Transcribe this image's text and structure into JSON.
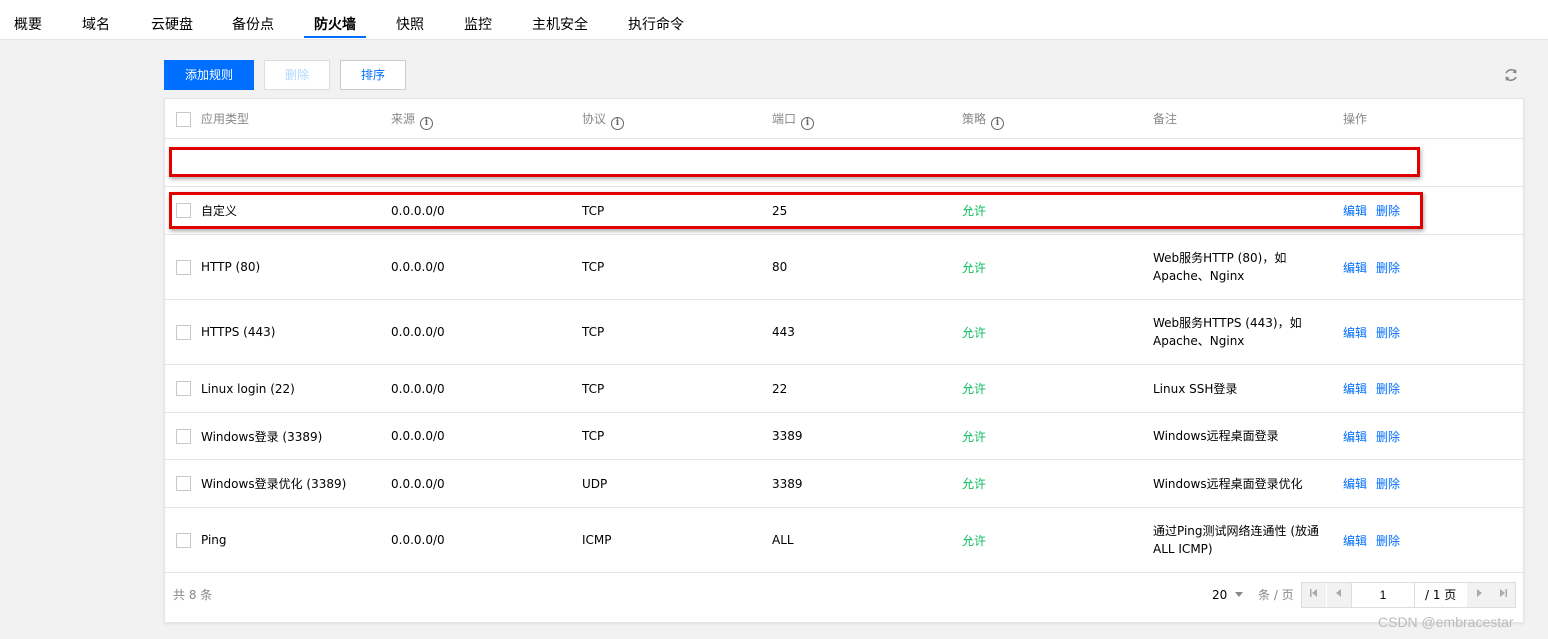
{
  "tabs": [
    {
      "label": "概要"
    },
    {
      "label": "域名"
    },
    {
      "label": "云硬盘"
    },
    {
      "label": "备份点"
    },
    {
      "label": "防火墙"
    },
    {
      "label": "快照"
    },
    {
      "label": "监控"
    },
    {
      "label": "主机安全"
    },
    {
      "label": "执行命令"
    }
  ],
  "active_tab": "防火墙",
  "toolbar": {
    "add_rule_label": "添加规则",
    "delete_label": "删除",
    "sort_label": "排序"
  },
  "table": {
    "headers": {
      "app_type": "应用类型",
      "source": "来源",
      "protocol": "协议",
      "port": "端口",
      "policy": "策略",
      "note": "备注",
      "action": "操作"
    },
    "rows": [
      {
        "app_type": "自定义",
        "source": "0.0.0.0/0",
        "protocol": "TCP",
        "port": "25",
        "policy": "允许",
        "note": ""
      },
      {
        "app_type": "HTTP (80)",
        "source": "0.0.0.0/0",
        "protocol": "TCP",
        "port": "80",
        "policy": "允许",
        "note": "Web服务HTTP (80)，如Apache、Nginx"
      },
      {
        "app_type": "HTTPS (443)",
        "source": "0.0.0.0/0",
        "protocol": "TCP",
        "port": "443",
        "policy": "允许",
        "note": "Web服务HTTPS (443)，如Apache、Nginx"
      },
      {
        "app_type": "Linux login (22)",
        "source": "0.0.0.0/0",
        "protocol": "TCP",
        "port": "22",
        "policy": "允许",
        "note": "Linux SSH登录"
      },
      {
        "app_type": "Windows登录 (3389)",
        "source": "0.0.0.0/0",
        "protocol": "TCP",
        "port": "3389",
        "policy": "允许",
        "note": "Windows远程桌面登录"
      },
      {
        "app_type": "Windows登录优化 (3389)",
        "source": "0.0.0.0/0",
        "protocol": "UDP",
        "port": "3389",
        "policy": "允许",
        "note": "Windows远程桌面登录优化"
      },
      {
        "app_type": "Ping",
        "source": "0.0.0.0/0",
        "protocol": "ICMP",
        "port": "ALL",
        "policy": "允许",
        "note": "通过Ping测试网络连通性 (放通ALL ICMP)"
      }
    ],
    "edit_label": "编辑",
    "delete_label": "删除"
  },
  "footer": {
    "total": "共 8 条",
    "page_size": "20",
    "page_size_unit": "条 / 页",
    "current_page": "1",
    "total_pages": "/ 1 页"
  },
  "watermark": "CSDN @embracestar",
  "colors": {
    "primary": "#006eff",
    "allow": "#0abf5b",
    "highlight": "#e00000"
  }
}
